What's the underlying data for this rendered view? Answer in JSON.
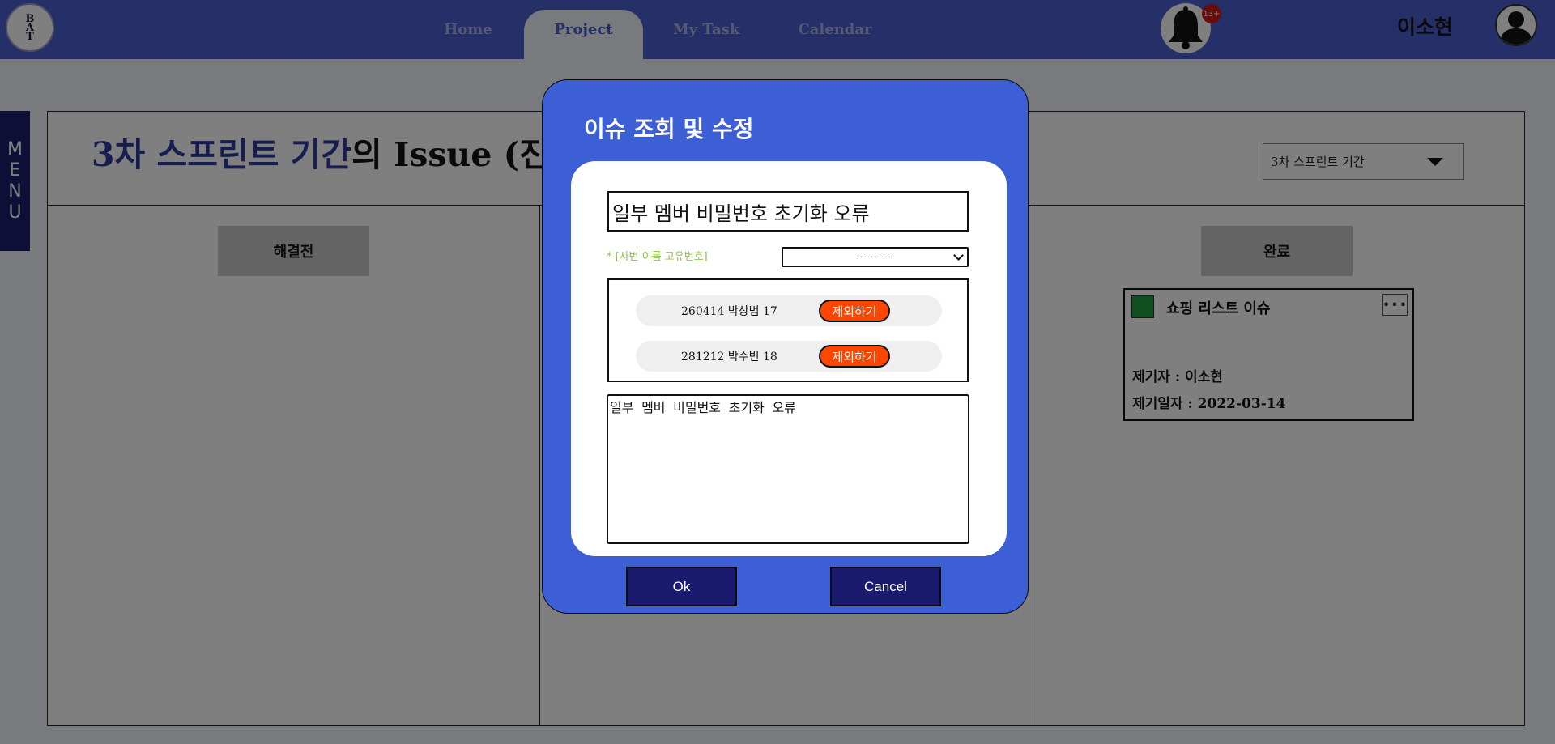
{
  "navbar": {
    "logo_text": "B\nA\nT",
    "tabs": [
      {
        "label": "Home",
        "active": false
      },
      {
        "label": "Project",
        "active": true
      },
      {
        "label": "My Task",
        "active": false
      },
      {
        "label": "Calendar",
        "active": false
      }
    ],
    "notification_count": "13+",
    "user_name": "이소현"
  },
  "sidebar": {
    "menu_label": "MENU"
  },
  "board": {
    "title_accent": "3차 스프린트 기간",
    "title_rest": "의 Issue (진행",
    "period_select_value": "3차 스프린트 기간",
    "columns": [
      {
        "label": "해결전"
      },
      {
        "label": "완료"
      }
    ],
    "card": {
      "title": "쇼핑 리스트 이슈",
      "reporter": "제기자 : 이소현",
      "date": "제기일자 : 2022-03-14",
      "status_color": "#1f9e3c"
    }
  },
  "modal": {
    "title": "이슈 조회 및 수정",
    "issue_title": "일부 멤버 비밀번호 초기화 오류",
    "member_label": "* [사번 이름 고유번호]",
    "member_select_value": "----------",
    "members": [
      {
        "text": "260414 박상범 17",
        "action": "제외하기"
      },
      {
        "text": "281212 박수빈 18",
        "action": "제외하기"
      }
    ],
    "description": "일부 멤버 비밀번호 초기화 오류",
    "ok_label": "Ok",
    "cancel_label": "Cancel"
  },
  "colors": {
    "navbar": "#4a5ed0",
    "modal": "#3d5fd6",
    "buttons": "#1a1a6e",
    "exclude_button": "#ff4500",
    "accent_title": "#2f3a9e"
  }
}
